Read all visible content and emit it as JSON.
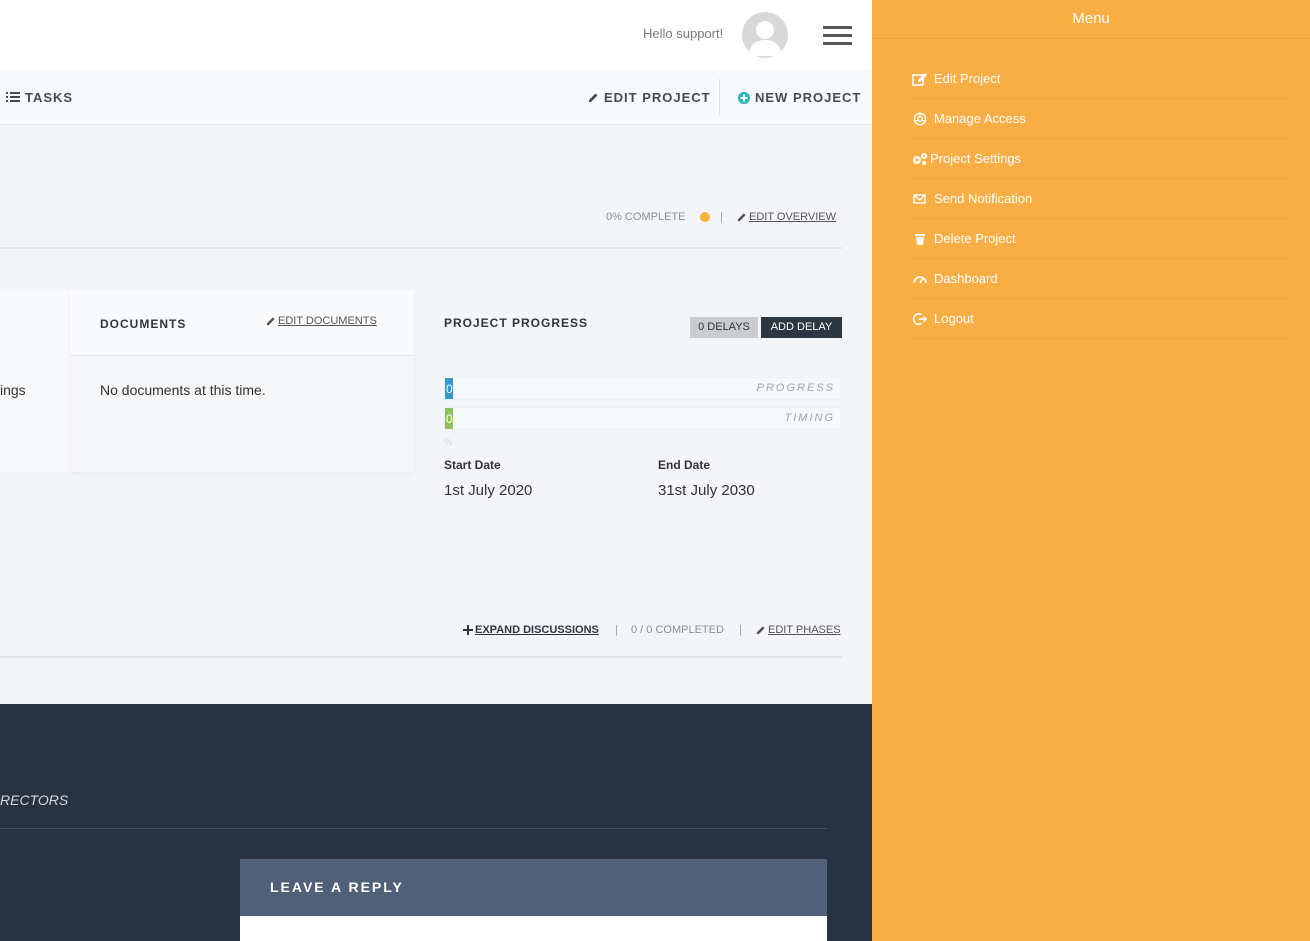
{
  "header": {
    "greeting": "Hello support!"
  },
  "actions": {
    "tasks": "TASKS",
    "edit_project": "EDIT PROJECT",
    "new_project": "NEW PROJECT"
  },
  "overview": {
    "complete": "0% COMPLETE",
    "separator": "|",
    "edit_overview": "EDIT OVERVIEW",
    "status_color": "#f5b431"
  },
  "left_panel": {
    "partial_text": "ings"
  },
  "documents": {
    "title": "DOCUMENTS",
    "edit_label": "EDIT DOCUMENTS",
    "empty_text": "No documents at this time."
  },
  "progress": {
    "title": "PROJECT PROGRESS",
    "delays_label": "0 DELAYS",
    "add_delay_label": "ADD DELAY",
    "progress_value": "0",
    "progress_label": "PROGRESS",
    "timing_value": "0",
    "timing_label": "TIMING",
    "percent_mark": "%",
    "start_label": "Start Date",
    "start_value": "1st July 2020",
    "end_label": "End Date",
    "end_value": "31st July 2030"
  },
  "phases": {
    "expand_label": "EXPAND DISCUSSIONS",
    "sep1": "|",
    "completed": "0 / 0 COMPLETED",
    "sep2": "|",
    "edit_phases": "EDIT PHASES"
  },
  "footer": {
    "directors_partial": "RECTORS",
    "reply_title": "LEAVE A REPLY"
  },
  "menu": {
    "title": "Menu",
    "items": [
      {
        "label": "Edit Project",
        "icon": "edit-icon"
      },
      {
        "label": "Manage Access",
        "icon": "access-icon"
      },
      {
        "label": "Project Settings",
        "icon": "gears-icon"
      },
      {
        "label": "Send Notification",
        "icon": "envelope-icon"
      },
      {
        "label": "Delete Project",
        "icon": "trash-icon"
      },
      {
        "label": "Dashboard",
        "icon": "gauge-icon"
      },
      {
        "label": "Logout",
        "icon": "logout-icon"
      }
    ]
  }
}
